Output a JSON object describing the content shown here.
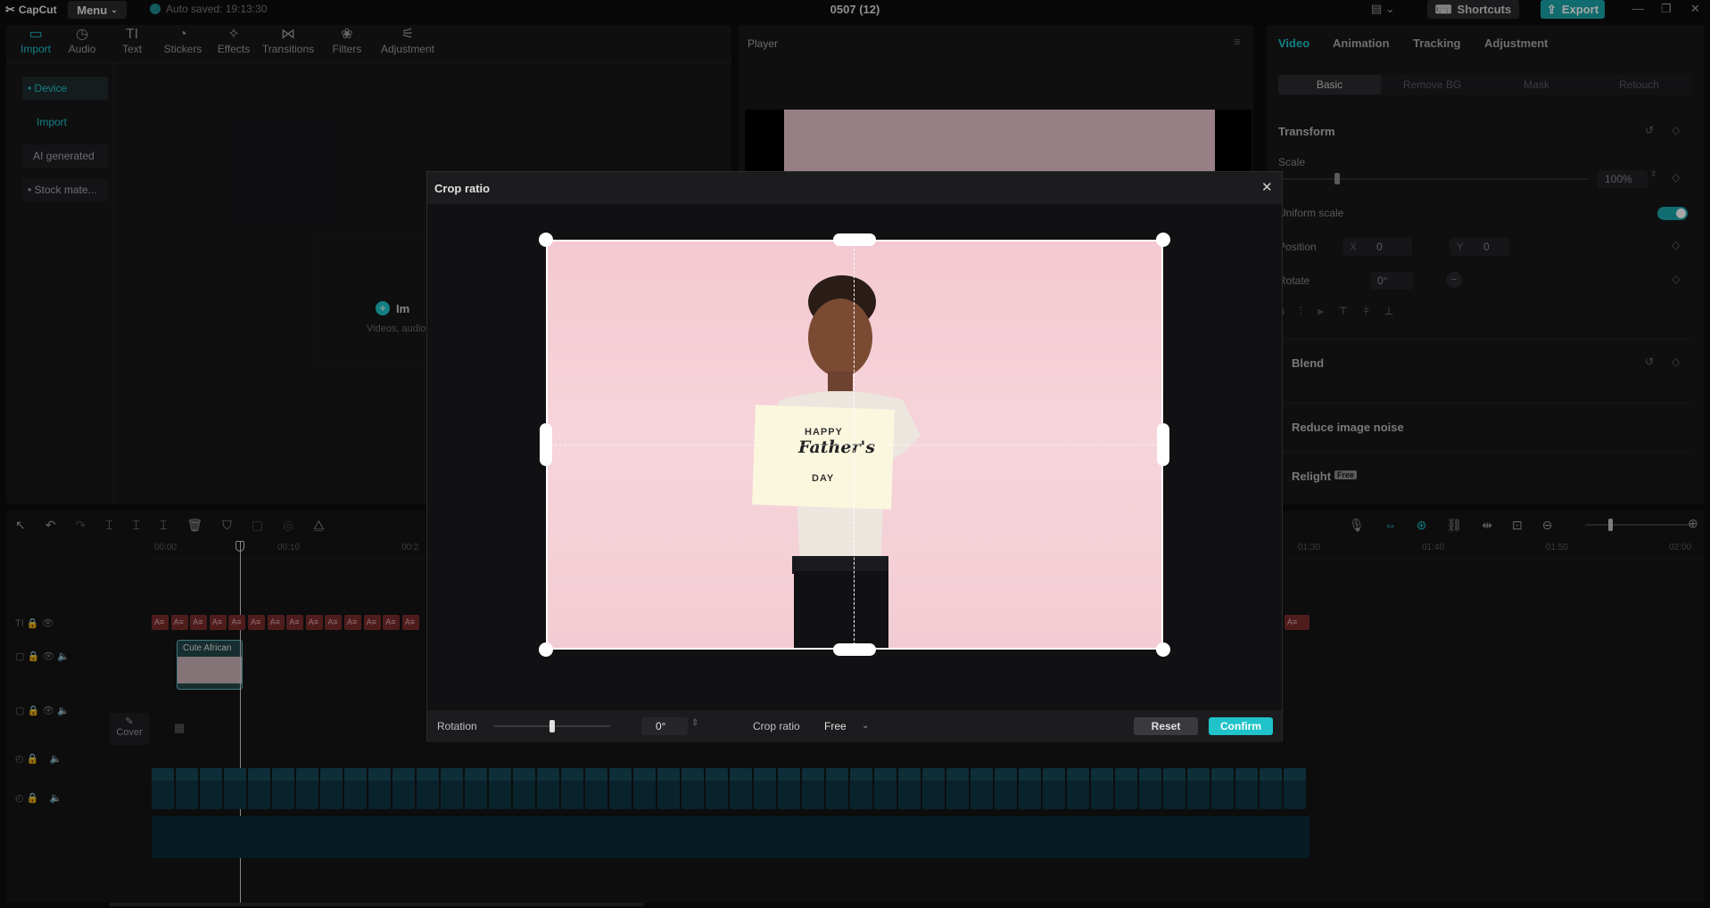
{
  "app": {
    "logo": "CapCut",
    "menu_label": "Menu",
    "autosave": "Auto saved: 19:13:30",
    "project_title": "0507 (12)",
    "shortcuts_label": "Shortcuts",
    "export_label": "Export"
  },
  "toolbar": {
    "items": [
      {
        "label": "Import",
        "icon": "import-icon"
      },
      {
        "label": "Audio",
        "icon": "audio-icon"
      },
      {
        "label": "Text",
        "icon": "text-icon"
      },
      {
        "label": "Stickers",
        "icon": "stickers-icon"
      },
      {
        "label": "Effects",
        "icon": "effects-icon"
      },
      {
        "label": "Transitions",
        "icon": "transitions-icon"
      },
      {
        "label": "Filters",
        "icon": "filters-icon"
      },
      {
        "label": "Adjustment",
        "icon": "adjustment-icon"
      }
    ]
  },
  "sidebar": {
    "device": "• Device",
    "import": "Import",
    "ai_generated": "AI generated",
    "stock": "• Stock mate..."
  },
  "media_area": {
    "import_label": "Im",
    "hint": "Videos, audios"
  },
  "player": {
    "title": "Player"
  },
  "right_panel": {
    "tabs": [
      "Video",
      "Animation",
      "Tracking",
      "Adjustment"
    ],
    "subtabs": [
      "Basic",
      "Remove BG",
      "Mask",
      "Retouch"
    ],
    "transform": "Transform",
    "scale_label": "Scale",
    "scale_value": "100%",
    "uniform_scale": "Uniform scale",
    "position_label": "Position",
    "pos_x_label": "X",
    "pos_x": "0",
    "pos_y_label": "Y",
    "pos_y": "0",
    "rotate_label": "Rotate",
    "rotate_value": "0°",
    "blend": "Blend",
    "reduce_noise": "Reduce image noise",
    "relight": "Relight",
    "relight_badge": "Free"
  },
  "timeline": {
    "ticks": [
      "00:00",
      "00:10",
      "00:2",
      "01:30",
      "01:40",
      "01:50",
      "02:00"
    ],
    "clip_label": "Cute African",
    "cover_label": "Cover",
    "text_clip_label": "A≡"
  },
  "modal": {
    "title": "Crop ratio",
    "image_text_1": "HAPPY",
    "image_text_2": "Father's",
    "image_text_3": "DAY",
    "rotation_label": "Rotation",
    "rotation_value": "0°",
    "rotation_fraction": 0.5,
    "crop_ratio_label": "Crop ratio",
    "crop_ratio_value": "Free",
    "reset_label": "Reset",
    "confirm_label": "Confirm"
  },
  "colors": {
    "accent": "#1fc3c9",
    "export": "#1aa6a9",
    "text_clip": "#7a2c2c",
    "audio_clip": "#0e3644"
  }
}
